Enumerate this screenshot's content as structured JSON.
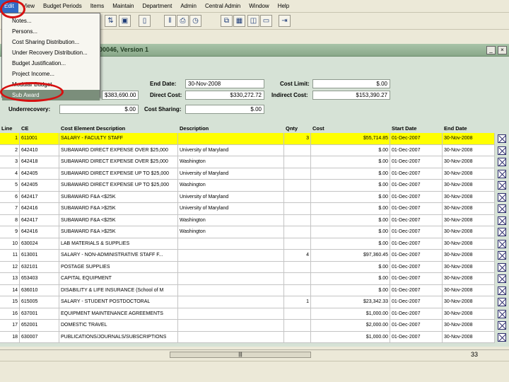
{
  "menubar": {
    "items": [
      "Edit",
      "View",
      "Budget Periods",
      "Items",
      "Maintain",
      "Department",
      "Admin",
      "Central Admin",
      "Window",
      "Help"
    ]
  },
  "edit_menu": {
    "items": [
      "Notes...",
      "Persons...",
      "Cost Sharing Distribution...",
      "Under Recovery Distribution...",
      "Budget Justification...",
      "Project Income...",
      "Modular Budget",
      "Sub Award"
    ],
    "highlighted_index": 7
  },
  "window": {
    "title": "00046, Version 1",
    "min_label": "_",
    "close_label": "×"
  },
  "summary": {
    "end_date_label": "End Date:",
    "end_date": "30-Nov-2008",
    "cost_limit_label": "Cost Limit:",
    "cost_limit": "$.00",
    "direct_cost_label": "Direct Cost:",
    "direct_cost": "$330,272.72",
    "indirect_cost_label": "Indirect Cost:",
    "indirect_cost": "$153,390.27",
    "total_cost": "$383,690.00",
    "underrecovery_label": "Underrecovery:",
    "underrecovery": "$.00",
    "cost_sharing_label": "Cost Sharing:",
    "cost_sharing": "$.00"
  },
  "table": {
    "headers": [
      "Line",
      "CE",
      "Cost Element Description",
      "Description",
      "Qnty",
      "Cost",
      "Start Date",
      "End Date"
    ],
    "rows": [
      {
        "line": "1",
        "ce": "611001",
        "ced": "SALARY - FACULTY STAFF",
        "desc": "",
        "qty": "3",
        "cost": "$55,714.85",
        "start": "01-Dec-2007",
        "end": "30-Nov-2008",
        "selected": true
      },
      {
        "line": "2",
        "ce": "642410",
        "ced": "SUBAWARD DIRECT EXPENSE OVER $25,000",
        "desc": "University of Maryland",
        "qty": "",
        "cost": "$.00",
        "start": "01-Dec-2007",
        "end": "30-Nov-2008"
      },
      {
        "line": "3",
        "ce": "642418",
        "ced": "SUBAWARD DIRECT EXPENSE OVER $25,000",
        "desc": "Washington",
        "qty": "",
        "cost": "$.00",
        "start": "01-Dec-2007",
        "end": "30-Nov-2008"
      },
      {
        "line": "4",
        "ce": "642405",
        "ced": "SUBAWARD DIRECT EXPENSE UP TO $25,000",
        "desc": "University of Maryland",
        "qty": "",
        "cost": "$.00",
        "start": "01-Dec-2007",
        "end": "30-Nov-2008"
      },
      {
        "line": "5",
        "ce": "642405",
        "ced": "SUBAWARD DIRECT EXPENSE UP TO $25,000",
        "desc": "Washington",
        "qty": "",
        "cost": "$.00",
        "start": "01-Dec-2007",
        "end": "30-Nov-2008"
      },
      {
        "line": "6",
        "ce": "642417",
        "ced": "SUBAWARD F&A <$25K",
        "desc": "University of Maryland",
        "qty": "",
        "cost": "$.00",
        "start": "01-Dec-2007",
        "end": "30-Nov-2008"
      },
      {
        "line": "7",
        "ce": "642416",
        "ced": "SUBAWARD F&A >$25K",
        "desc": "University of Maryland",
        "qty": "",
        "cost": "$.00",
        "start": "01-Dec-2007",
        "end": "30-Nov-2008"
      },
      {
        "line": "8",
        "ce": "642417",
        "ced": "SUBAWARD F&A <$25K",
        "desc": "Washington",
        "qty": "",
        "cost": "$.00",
        "start": "01-Dec-2007",
        "end": "30-Nov-2008"
      },
      {
        "line": "9",
        "ce": "642416",
        "ced": "SUBAWARD F&A >$25K",
        "desc": "Washington",
        "qty": "",
        "cost": "$.00",
        "start": "01-Dec-2007",
        "end": "30-Nov-2008"
      },
      {
        "line": "10",
        "ce": "630024",
        "ced": "LAB MATERIALS & SUPPLIES",
        "desc": "",
        "qty": "",
        "cost": "$.00",
        "start": "01-Dec-2007",
        "end": "30-Nov-2008"
      },
      {
        "line": "11",
        "ce": "613001",
        "ced": "SALARY - NON-ADMINISTRATIVE STAFF F...",
        "desc": "",
        "qty": "4",
        "cost": "$97,360.45",
        "start": "01-Dec-2007",
        "end": "30-Nov-2008"
      },
      {
        "line": "12",
        "ce": "632101",
        "ced": "POSTAGE SUPPLIES",
        "desc": "",
        "qty": "",
        "cost": "$.00",
        "start": "01-Dec-2007",
        "end": "30-Nov-2008"
      },
      {
        "line": "13",
        "ce": "653403",
        "ced": "CAPITAL EQUIPMENT",
        "desc": "",
        "qty": "",
        "cost": "$.00",
        "start": "01-Dec-2007",
        "end": "30-Nov-2008"
      },
      {
        "line": "14",
        "ce": "636010",
        "ced": "DISABILITY & LIFE INSURANCE (School of M",
        "desc": "",
        "qty": "",
        "cost": "$.00",
        "start": "01-Dec-2007",
        "end": "30-Nov-2008"
      },
      {
        "line": "15",
        "ce": "615005",
        "ced": "SALARY - STUDENT POSTDOCTORAL",
        "desc": "",
        "qty": "1",
        "cost": "$23,342.33",
        "start": "01-Dec-2007",
        "end": "30-Nov-2008"
      },
      {
        "line": "16",
        "ce": "637001",
        "ced": "EQUIPMENT MAINTENANCE AGREEMENTS",
        "desc": "",
        "qty": "",
        "cost": "$1,000.00",
        "start": "01-Dec-2007",
        "end": "30-Nov-2008"
      },
      {
        "line": "17",
        "ce": "652001",
        "ced": "DOMESTIC TRAVEL",
        "desc": "",
        "qty": "",
        "cost": "$2,000.00",
        "start": "01-Dec-2007",
        "end": "30-Nov-2008"
      },
      {
        "line": "18",
        "ce": "630007",
        "ced": "PUBLICATIONS/JOURNALS/SUBSCRIPTIONS",
        "desc": "",
        "qty": "",
        "cost": "$1,000.00",
        "start": "01-Dec-2007",
        "end": "30-Nov-2008"
      }
    ]
  },
  "page_number": "33",
  "scroll_grip": "|||",
  "colors": {
    "selected_row": "#ffff00",
    "annotation_ring": "#d61010",
    "panel": "#d6e2d6"
  }
}
